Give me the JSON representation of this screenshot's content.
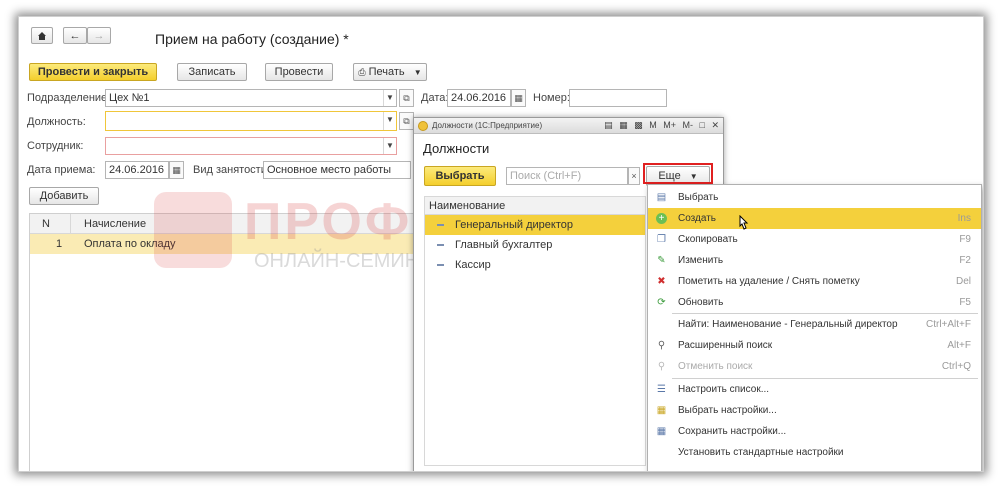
{
  "form": {
    "title": "Прием на работу (создание) *",
    "post_close": "Провести и закрыть",
    "record": "Записать",
    "post": "Провести",
    "print": "Печать",
    "fields": {
      "department_label": "Подразделение:",
      "department_value": "Цех №1",
      "date_label": "Дата:",
      "date_value": "24.06.2016",
      "number_label": "Номер:",
      "position_label": "Должность:",
      "employee_label": "Сотрудник:",
      "hire_date_label": "Дата приема:",
      "hire_date_value": "24.06.2016",
      "employment_label": "Вид занятости:",
      "employment_value": "Основное место работы"
    },
    "add": "Добавить",
    "table": {
      "col_n": "N",
      "col_accrual": "Начисление",
      "rows": [
        {
          "n": "1",
          "accrual": "Оплата по окладу"
        }
      ]
    }
  },
  "dialog": {
    "window_title": "Должности (1С:Предприятие)",
    "tb_icons": [
      "M",
      "M+",
      "M-"
    ],
    "heading": "Должности",
    "choose": "Выбрать",
    "search_placeholder": "Поиск (Ctrl+F)",
    "more": "Еще",
    "list_header": "Наименование",
    "items": [
      "Генеральный директор",
      "Главный бухгалтер",
      "Кассир"
    ]
  },
  "menu": {
    "items": [
      {
        "label": "Выбрать",
        "shortcut": "",
        "icon": "select-icon"
      },
      {
        "label": "Создать",
        "shortcut": "Ins",
        "icon": "create-icon"
      },
      {
        "label": "Скопировать",
        "shortcut": "F9",
        "icon": "copy-icon"
      },
      {
        "label": "Изменить",
        "shortcut": "F2",
        "icon": "edit-icon"
      },
      {
        "label": "Пометить на удаление / Снять пометку",
        "shortcut": "Del",
        "icon": "delete-mark-icon"
      },
      {
        "label": "Обновить",
        "shortcut": "F5",
        "icon": "refresh-icon"
      },
      {
        "label": "Найти: Наименование - Генеральный директор",
        "shortcut": "Ctrl+Alt+F",
        "icon": ""
      },
      {
        "label": "Расширенный поиск",
        "shortcut": "Alt+F",
        "icon": "search-icon"
      },
      {
        "label": "Отменить поиск",
        "shortcut": "Ctrl+Q",
        "icon": "cancel-search-icon"
      },
      {
        "label": "Настроить список...",
        "shortcut": "",
        "icon": "list-settings-icon"
      },
      {
        "label": "Выбрать настройки...",
        "shortcut": "",
        "icon": "choose-settings-icon"
      },
      {
        "label": "Сохранить настройки...",
        "shortcut": "",
        "icon": "save-settings-icon"
      },
      {
        "label": "Установить стандартные настройки",
        "shortcut": "",
        "icon": ""
      }
    ]
  },
  "watermark": {
    "big": "ПРОФБУХ8.ру",
    "small": "ОНЛАЙН-СЕМИНАРЫ И ВИДЕОКУРСЫ 1С:8"
  },
  "colors": {
    "accent_yellow": "#f4d03c",
    "highlight_red": "#e02020"
  }
}
